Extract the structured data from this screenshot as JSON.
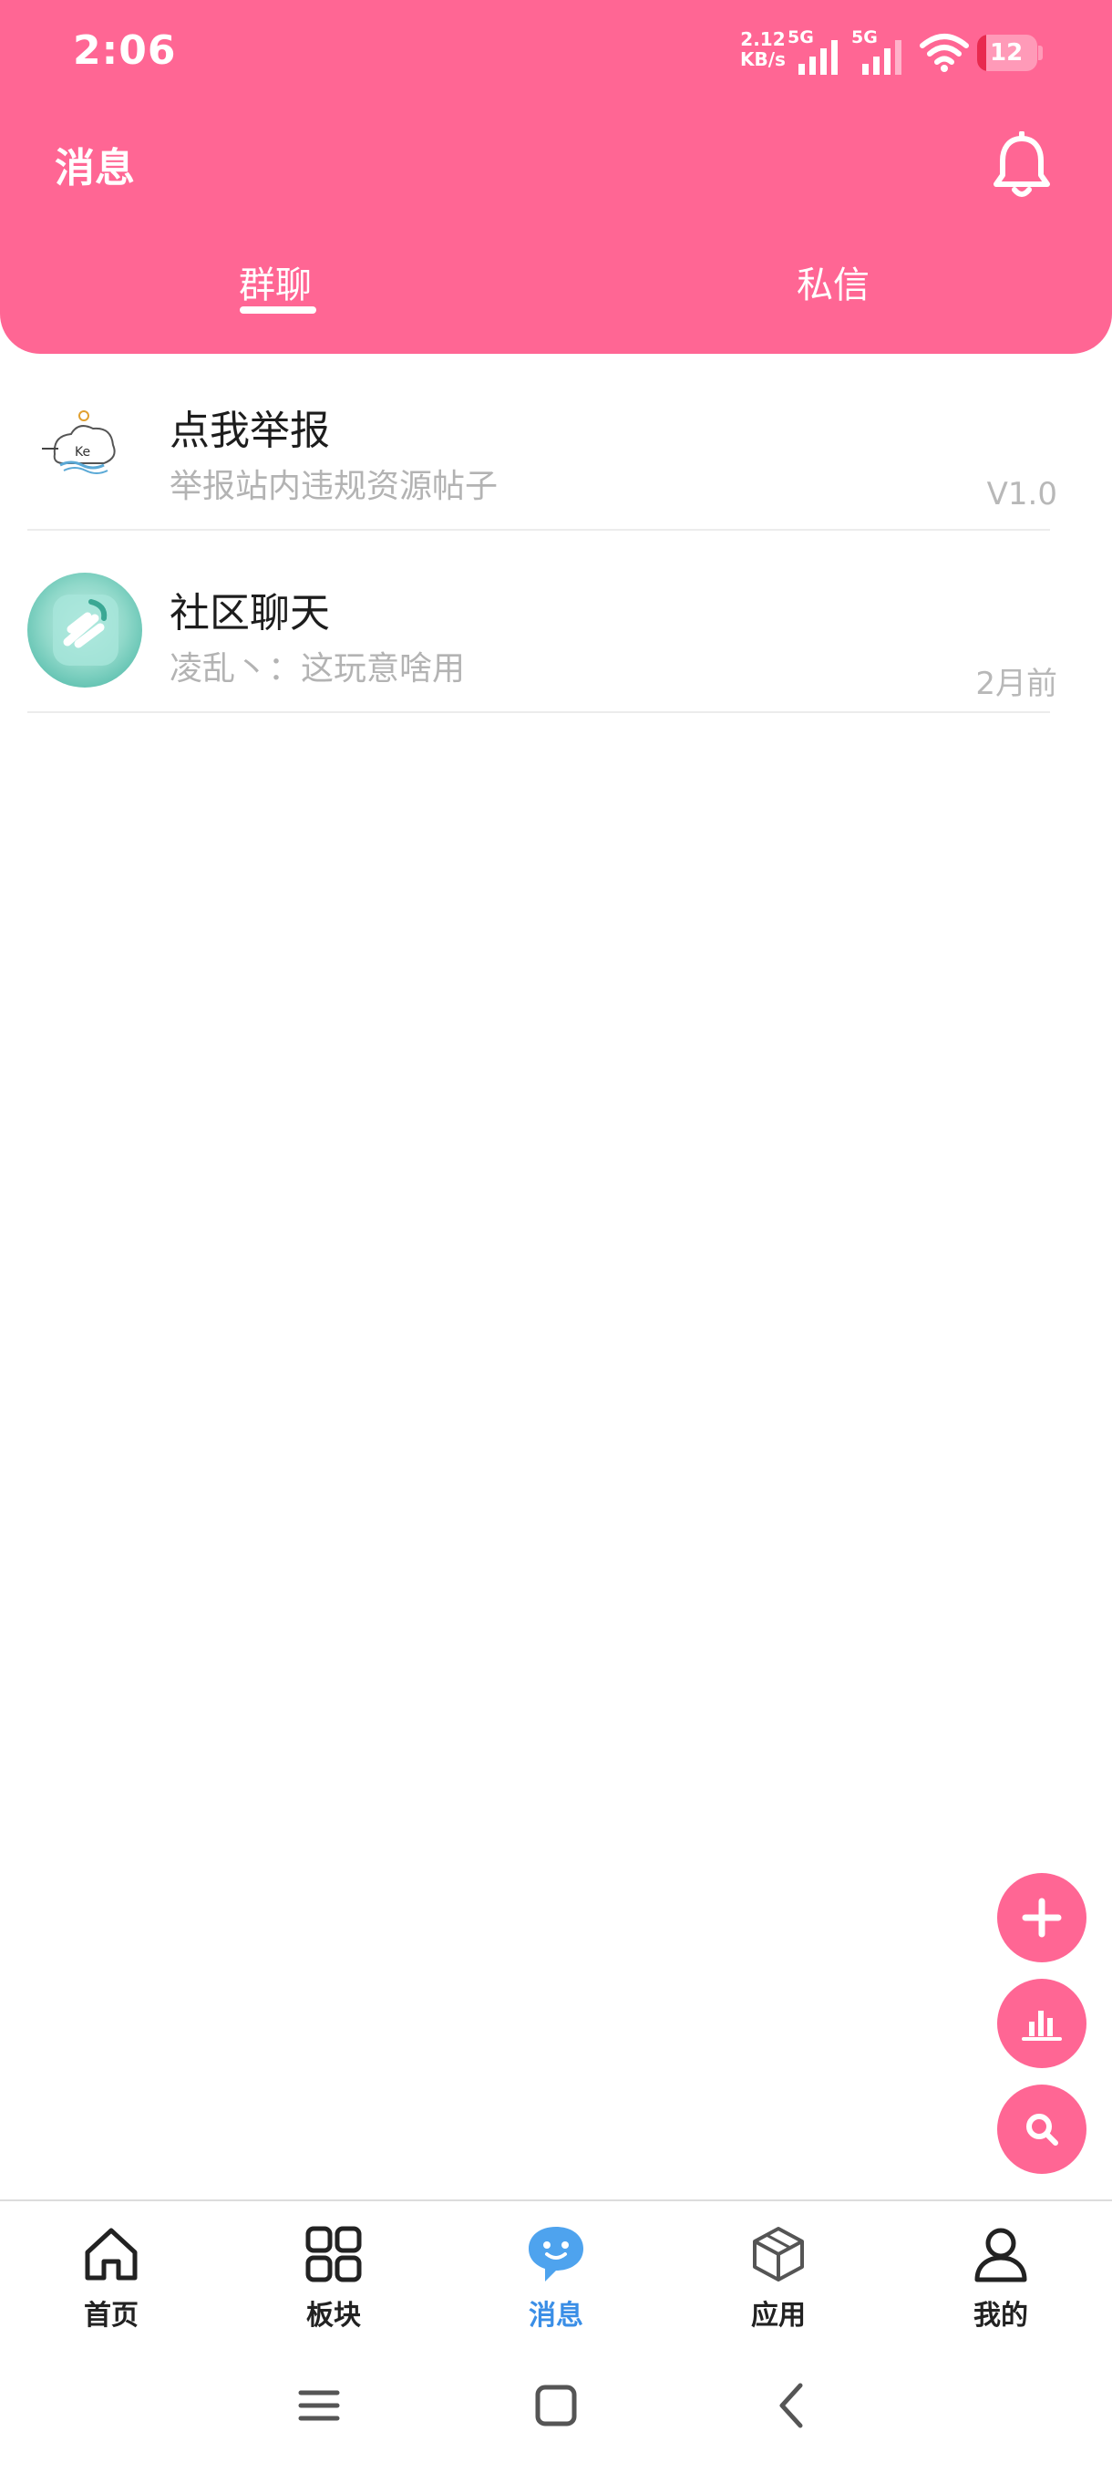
{
  "status_bar": {
    "time": "2:06",
    "net_speed_value": "2.12",
    "net_speed_unit": "KB/s",
    "signal_1_label": "5G",
    "signal_2_label": "5G",
    "battery_level": "12"
  },
  "header": {
    "title": "消息",
    "tabs": [
      {
        "label": "群聊",
        "active": true
      },
      {
        "label": "私信",
        "active": false
      }
    ]
  },
  "conversations": [
    {
      "title": "点我举报",
      "subtitle": "举报站内违规资源帖子",
      "meta": "V1.0",
      "avatar_icon": "cloud-logo-avatar"
    },
    {
      "title": "社区聊天",
      "subtitle": "凌乱丶：这玩意啥用",
      "meta": "2月前",
      "avatar_icon": "green-glass-avatar"
    }
  ],
  "fabs": [
    {
      "icon": "plus-icon"
    },
    {
      "icon": "bar-chart-icon"
    },
    {
      "icon": "search-icon"
    }
  ],
  "bottom_nav": [
    {
      "label": "首页",
      "icon": "home-icon",
      "active": false
    },
    {
      "label": "板块",
      "icon": "grid-icon",
      "active": false
    },
    {
      "label": "消息",
      "icon": "chat-bubble-icon",
      "active": true
    },
    {
      "label": "应用",
      "icon": "cube-icon",
      "active": false
    },
    {
      "label": "我的",
      "icon": "user-icon",
      "active": false
    }
  ],
  "colors": {
    "brand_pink": "#ff6694",
    "active_blue": "#3a8ee6"
  }
}
